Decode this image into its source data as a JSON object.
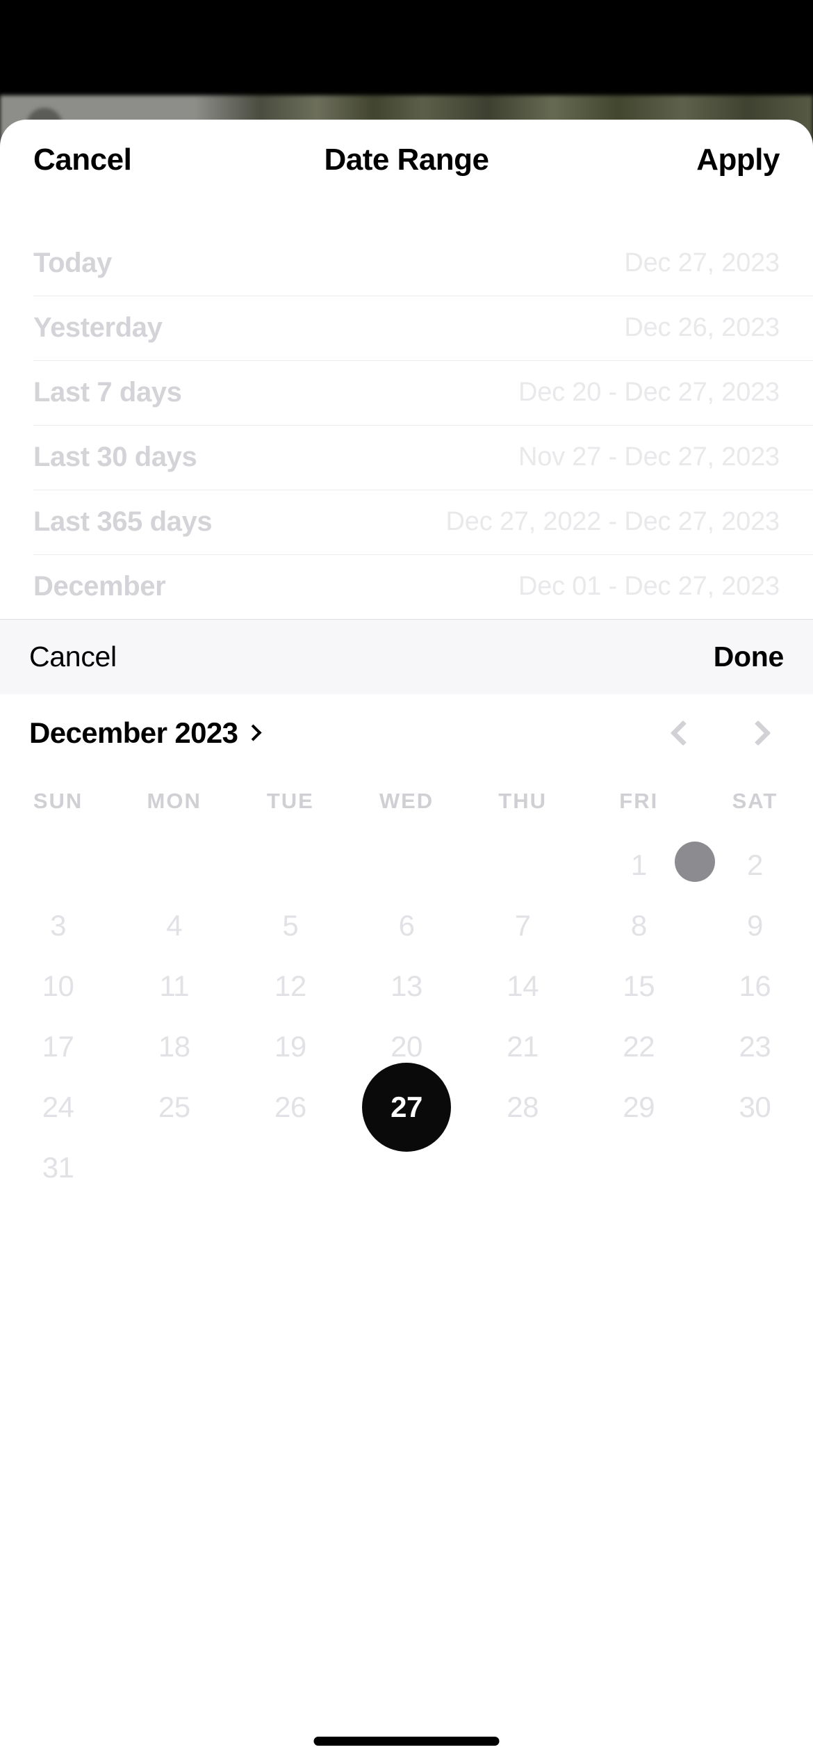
{
  "sheet": {
    "header": {
      "cancel_label": "Cancel",
      "title": "Date Range",
      "apply_label": "Apply"
    },
    "presets": [
      {
        "label": "Today",
        "value": "Dec 27, 2023"
      },
      {
        "label": "Yesterday",
        "value": "Dec 26, 2023"
      },
      {
        "label": "Last 7 days",
        "value": "Dec 20 - Dec 27, 2023"
      },
      {
        "label": "Last 30 days",
        "value": "Nov 27 - Dec 27, 2023"
      },
      {
        "label": "Last 365 days",
        "value": "Dec 27, 2022 - Dec 27, 2023"
      },
      {
        "label": "December",
        "value": "Dec 01 - Dec 27, 2023"
      }
    ]
  },
  "picker_toolbar": {
    "cancel_label": "Cancel",
    "done_label": "Done"
  },
  "calendar": {
    "month_label": "December 2023",
    "month_chevron_icon": "chevron-right-icon",
    "prev_icon": "chevron-left-icon",
    "next_icon": "chevron-right-icon",
    "weekdays": [
      "SUN",
      "MON",
      "TUE",
      "WED",
      "THU",
      "FRI",
      "SAT"
    ],
    "leading_blanks": 5,
    "days": [
      1,
      2,
      3,
      4,
      5,
      6,
      7,
      8,
      9,
      10,
      11,
      12,
      13,
      14,
      15,
      16,
      17,
      18,
      19,
      20,
      21,
      22,
      23,
      24,
      25,
      26,
      27,
      28,
      29,
      30,
      31
    ],
    "selected_day": 27
  },
  "colors": {
    "selected_day_bg": "#0a0a0a",
    "selected_day_text": "#ffffff",
    "toolbar_bg": "#f7f6f9",
    "touch_indicator": "#8c8c90",
    "faded_label": "#d4d4d8",
    "faded_value": "#e9e9ec",
    "weekday_text": "#cfcfd4",
    "day_text": "#e2e2e6"
  },
  "system": {
    "home_indicator": "home-indicator"
  }
}
